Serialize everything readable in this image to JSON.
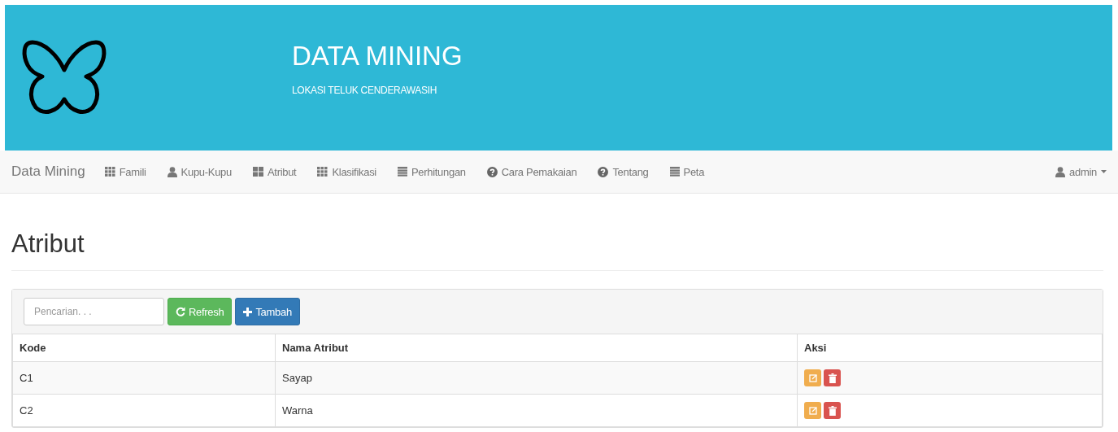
{
  "header": {
    "title": "DATA MINING",
    "subtitle": "LOKASI TELUK CENDERAWASIH"
  },
  "navbar": {
    "brand": "Data Mining",
    "items": [
      {
        "label": "Famili",
        "kind": "grid"
      },
      {
        "label": "Kupu-Kupu",
        "kind": "user"
      },
      {
        "label": "Atribut",
        "kind": "blocks"
      },
      {
        "label": "Klasifikasi",
        "kind": "grid"
      },
      {
        "label": "Perhitungan",
        "kind": "list"
      },
      {
        "label": "Cara Pemakaian",
        "kind": "help"
      },
      {
        "label": "Tentang",
        "kind": "help"
      },
      {
        "label": "Peta",
        "kind": "list"
      }
    ],
    "user": "admin"
  },
  "page_title": "Atribut",
  "toolbar": {
    "search": {
      "placeholder": "Pencarian. . ."
    },
    "refresh": "Refresh",
    "add": "Tambah"
  },
  "table": {
    "columns": [
      "Kode",
      "Nama Atribut",
      "Aksi"
    ],
    "rows": [
      {
        "kode": "C1",
        "nama": "Sayap"
      },
      {
        "kode": "C2",
        "nama": "Warna"
      }
    ]
  }
}
